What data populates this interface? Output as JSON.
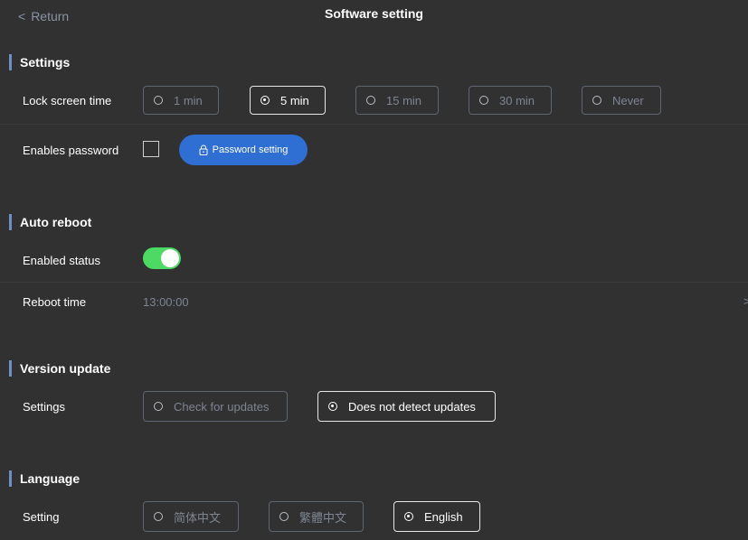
{
  "header": {
    "back_label": "Return",
    "title": "Software setting"
  },
  "sections": {
    "settings": {
      "title": "Settings",
      "lock_label": "Lock screen time",
      "lock_options": [
        "1 min",
        "5 min",
        "15 min",
        "30 min",
        "Never"
      ],
      "lock_selected": "5 min",
      "password_label": "Enables password",
      "password_enabled": false,
      "password_button": "Password setting"
    },
    "auto_reboot": {
      "title": "Auto reboot",
      "enabled_label": "Enabled status",
      "enabled": true,
      "time_label": "Reboot time",
      "time_value": "13:00:00"
    },
    "version_update": {
      "title": "Version update",
      "settings_label": "Settings",
      "options": [
        "Check for updates",
        "Does not detect updates"
      ],
      "selected": "Does not detect updates"
    },
    "language": {
      "title": "Language",
      "setting_label": "Setting",
      "options": [
        "简体中文",
        "繁體中文",
        "English"
      ],
      "selected": "English"
    }
  },
  "colors": {
    "background": "#313131",
    "accent_bar": "#6f8ec4",
    "button_blue": "#2f6ed2",
    "toggle_on": "#4cd964"
  }
}
